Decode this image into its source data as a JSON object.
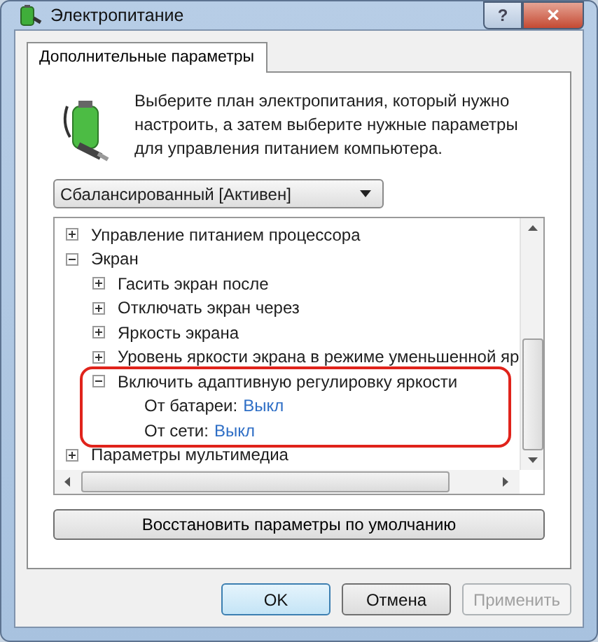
{
  "window": {
    "title": "Электропитание",
    "buttons": [
      "?",
      "✕"
    ]
  },
  "tabs": [
    {
      "label": "Дополнительные параметры",
      "selected": true
    }
  ],
  "description": "Выберите план электропитания, который нужно настроить, а затем выберите нужные параметры для управления питанием компьютера.",
  "plan_dropdown": {
    "value": "Сбалансированный [Активен]"
  },
  "tree": [
    {
      "kind": "group",
      "label": "Управление питанием процессора",
      "expanded": false
    },
    {
      "kind": "group",
      "label": "Экран",
      "expanded": true,
      "children": [
        {
          "kind": "group",
          "label": "Гасить экран после",
          "expanded": false
        },
        {
          "kind": "group",
          "label": "Отключать экран через",
          "expanded": false
        },
        {
          "kind": "group",
          "label": "Яркость экрана",
          "expanded": false
        },
        {
          "kind": "group",
          "label": "Уровень яркости экрана в режиме уменьшенной яр",
          "expanded": false
        },
        {
          "kind": "group",
          "label": "Включить адаптивную регулировку яркости",
          "expanded": true,
          "highlighted": true,
          "children": [
            {
              "kind": "setting",
              "label": "От батареи:",
              "value": "Выкл"
            },
            {
              "kind": "setting",
              "label": "От сети:",
              "value": "Выкл"
            }
          ]
        }
      ]
    },
    {
      "kind": "group",
      "label": "Параметры мультимедиа",
      "expanded": false
    }
  ],
  "restore_button": "Восстановить параметры по умолчанию",
  "buttons": [
    {
      "label": "OK",
      "default": true,
      "disabled": false
    },
    {
      "label": "Отмена",
      "default": false,
      "disabled": false
    },
    {
      "label": "Применить",
      "default": false,
      "disabled": true
    }
  ]
}
